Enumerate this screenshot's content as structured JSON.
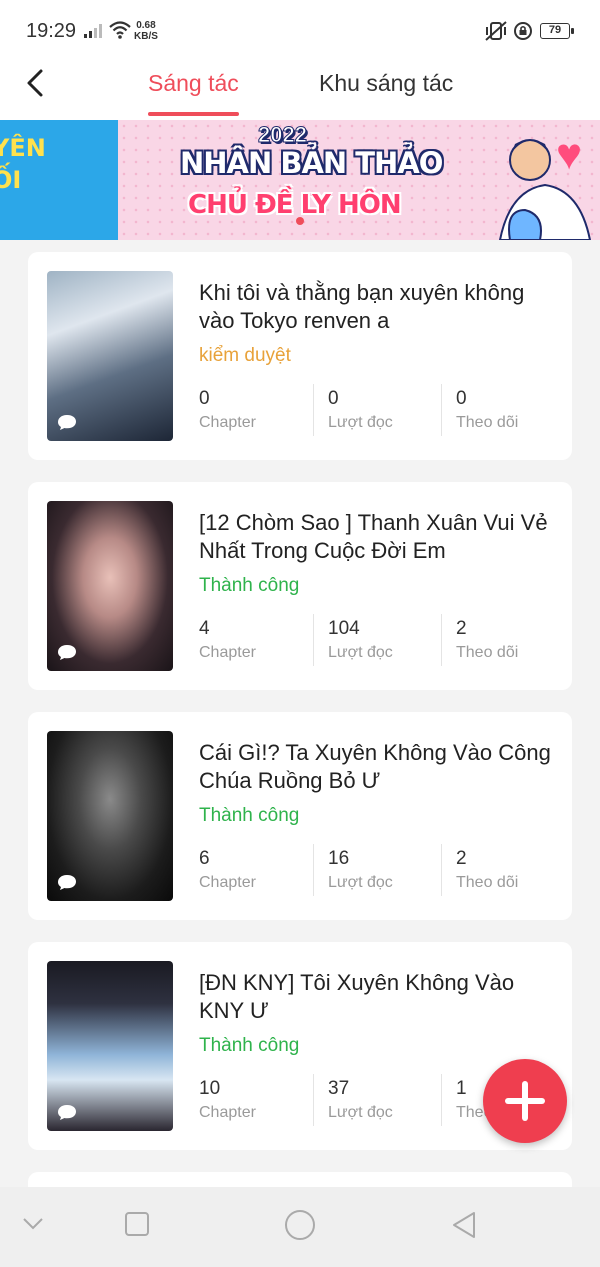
{
  "status_bar": {
    "time": "19:29",
    "net_speed_value": "0.68",
    "net_speed_unit": "KB/S",
    "battery": "79"
  },
  "header": {
    "tabs": [
      {
        "label": "Sáng tác",
        "active": true
      },
      {
        "label": "Khu sáng tác",
        "active": false
      }
    ]
  },
  "banner": {
    "left_text_1": "YÊN",
    "left_text_2": "ỐI",
    "year": "2022",
    "line1": "NHÂN BẢN THẢO",
    "line2": "CHỦ ĐỀ LY HÔN"
  },
  "stories": [
    {
      "title": "Khi tôi và thằng bạn xuyên không vào Tokyo renven a",
      "status": "kiểm duyệt",
      "chapters": "0",
      "reads": "0",
      "follows": "0"
    },
    {
      "title": "[12 Chòm Sao ] Thanh Xuân Vui Vẻ Nhất Trong Cuộc Đời Em",
      "status": "Thành công",
      "chapters": "4",
      "reads": "104",
      "follows": "2"
    },
    {
      "title": "Cái Gì!? Ta Xuyên Không Vào Công Chúa Ruồng Bỏ Ư",
      "status": "Thành công",
      "chapters": "6",
      "reads": "16",
      "follows": "2"
    },
    {
      "title": "[ĐN KNY] Tôi Xuyên Không Vào KNY Ư",
      "status": "Thành công",
      "chapters": "10",
      "reads": "37",
      "follows": "1"
    }
  ],
  "labels": {
    "chapter": "Chapter",
    "reads": "Lượt đọc",
    "follows": "Theo dõi"
  },
  "colors": {
    "accent": "#ef4d5a",
    "status_review": "#e8a23a",
    "status_success": "#2fb34c",
    "fab": "#ef3e4f"
  }
}
